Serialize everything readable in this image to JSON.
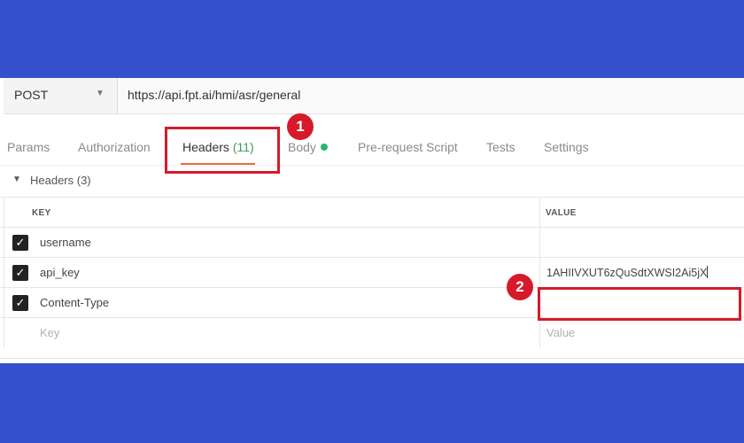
{
  "request": {
    "method": "POST",
    "url": "https://api.fpt.ai/hmi/asr/general"
  },
  "tabs": [
    {
      "label": "Params"
    },
    {
      "label": "Authorization"
    },
    {
      "label": "Headers",
      "count": "(11)"
    },
    {
      "label": "Body"
    },
    {
      "label": "Pre-request Script"
    },
    {
      "label": "Tests"
    },
    {
      "label": "Settings"
    }
  ],
  "headers_section": {
    "title": "Headers (3)",
    "columns": {
      "key": "KEY",
      "value": "VALUE"
    },
    "rows": [
      {
        "key": "username",
        "value": "",
        "checked": true
      },
      {
        "key": "api_key",
        "value": "1AHIIVXUT6zQuSdtXWSI2Ai5jX",
        "checked": true
      },
      {
        "key": "Content-Type",
        "value": "",
        "checked": true
      }
    ],
    "new_row": {
      "key_placeholder": "Key",
      "value_placeholder": "Value"
    }
  },
  "annotations": [
    {
      "number": "1"
    },
    {
      "number": "2"
    }
  ],
  "colors": {
    "frame": "#3450cc",
    "highlight": "#d61a2b",
    "active_tab_underline": "#f26b3a",
    "count_green": "#3e9b57",
    "body_dot": "#26b373"
  }
}
